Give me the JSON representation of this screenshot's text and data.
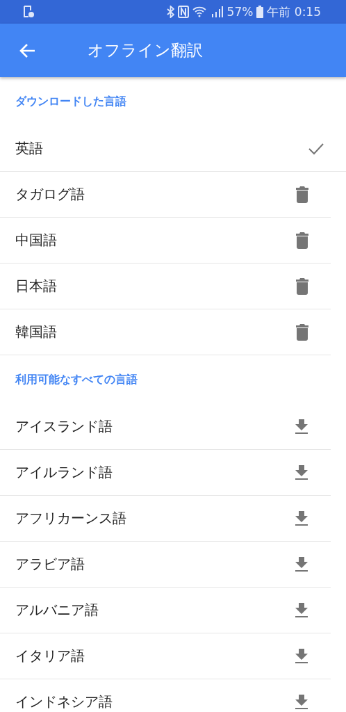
{
  "status_bar": {
    "battery": "57%",
    "time": "午前 0:15"
  },
  "app_bar": {
    "title": "オフライン翻訳"
  },
  "sections": [
    {
      "title": "ダウンロードした言語",
      "items": [
        {
          "name": "英語",
          "kind": "default"
        },
        {
          "name": "タガログ語",
          "kind": "downloaded"
        },
        {
          "name": "中国語",
          "kind": "downloaded"
        },
        {
          "name": "日本語",
          "kind": "downloaded"
        },
        {
          "name": "韓国語",
          "kind": "downloaded"
        }
      ]
    },
    {
      "title": "利用可能なすべての言語",
      "items": [
        {
          "name": "アイスランド語",
          "kind": "available"
        },
        {
          "name": "アイルランド語",
          "kind": "available"
        },
        {
          "name": "アフリカーンス語",
          "kind": "available"
        },
        {
          "name": "アラビア語",
          "kind": "available"
        },
        {
          "name": "アルバニア語",
          "kind": "available"
        },
        {
          "name": "イタリア語",
          "kind": "available"
        },
        {
          "name": "インドネシア語",
          "kind": "available"
        }
      ]
    }
  ]
}
